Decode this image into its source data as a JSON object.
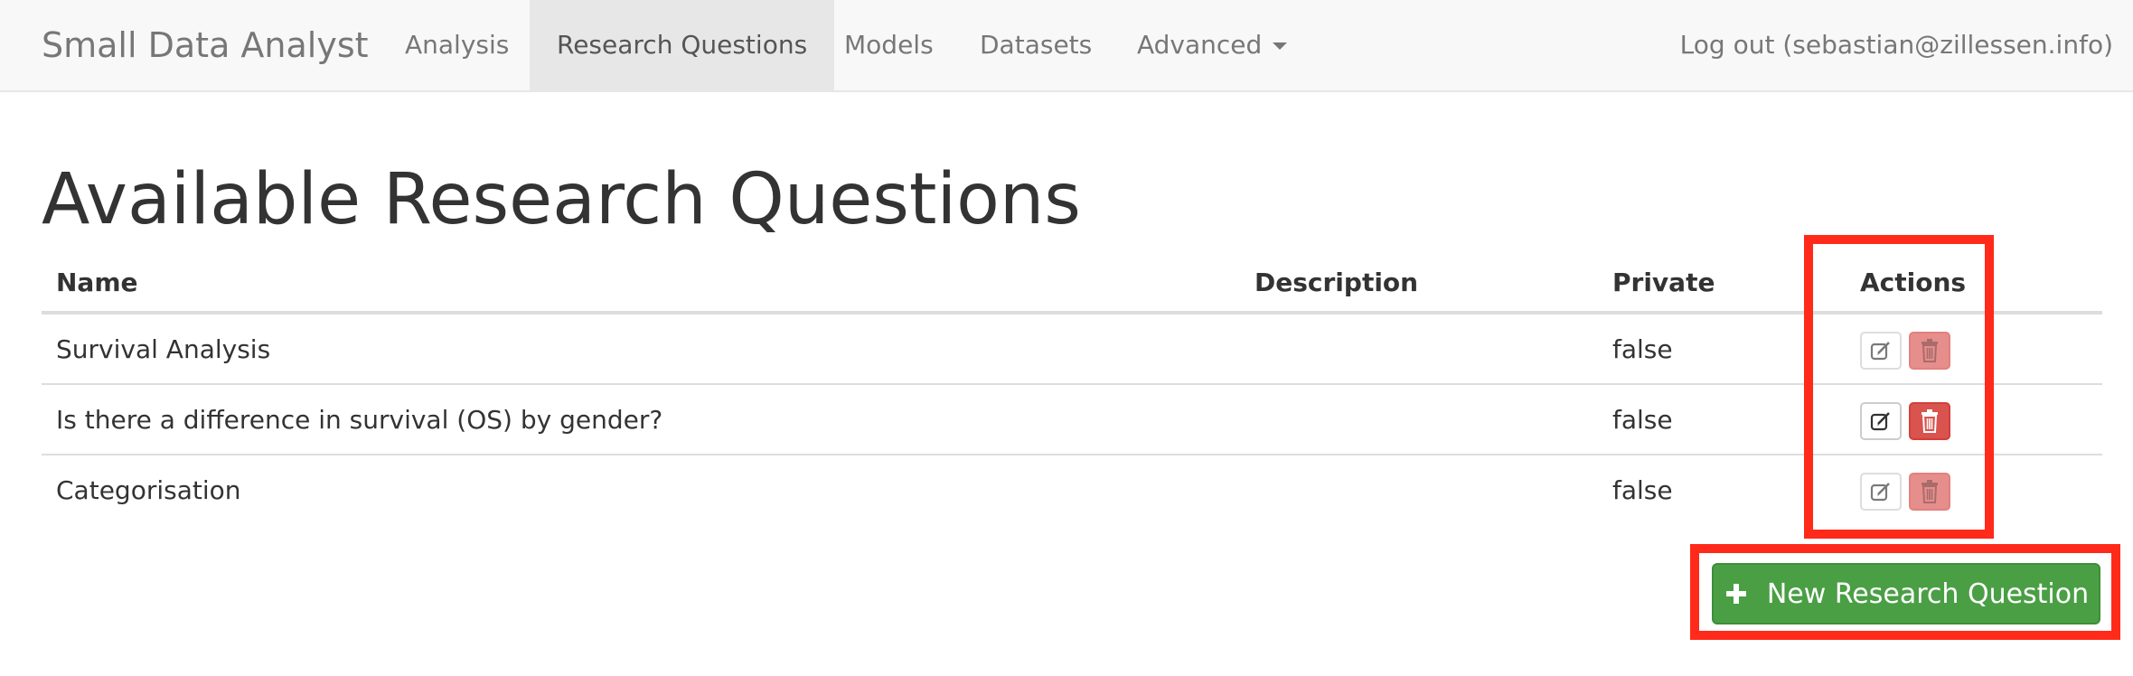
{
  "navbar": {
    "brand": "Small Data Analyst",
    "items": [
      {
        "label": "Analysis"
      },
      {
        "label": "Research Questions",
        "active": true
      },
      {
        "label": "Models"
      },
      {
        "label": "Datasets"
      },
      {
        "label": "Advanced",
        "dropdown": true
      }
    ],
    "logout": "Log out (sebastian@zillessen.info)"
  },
  "page": {
    "title": "Available Research Questions"
  },
  "table": {
    "headers": {
      "name": "Name",
      "description": "Description",
      "private": "Private",
      "actions": "Actions"
    },
    "rows": [
      {
        "name": "Survival Analysis",
        "description": "",
        "private": "false"
      },
      {
        "name": "Is there a difference in survival (OS) by gender?",
        "description": "",
        "private": "false"
      },
      {
        "name": "Categorisation",
        "description": "",
        "private": "false"
      }
    ]
  },
  "buttons": {
    "new_research_question": "New Research Question"
  },
  "icons": {
    "edit": "edit-icon",
    "delete": "trash-icon",
    "add": "plus-icon"
  },
  "colors": {
    "highlight": "#ff2a1a",
    "success": "#4a9f45",
    "danger": "#d9534f",
    "navbar_bg": "#f8f8f8"
  }
}
